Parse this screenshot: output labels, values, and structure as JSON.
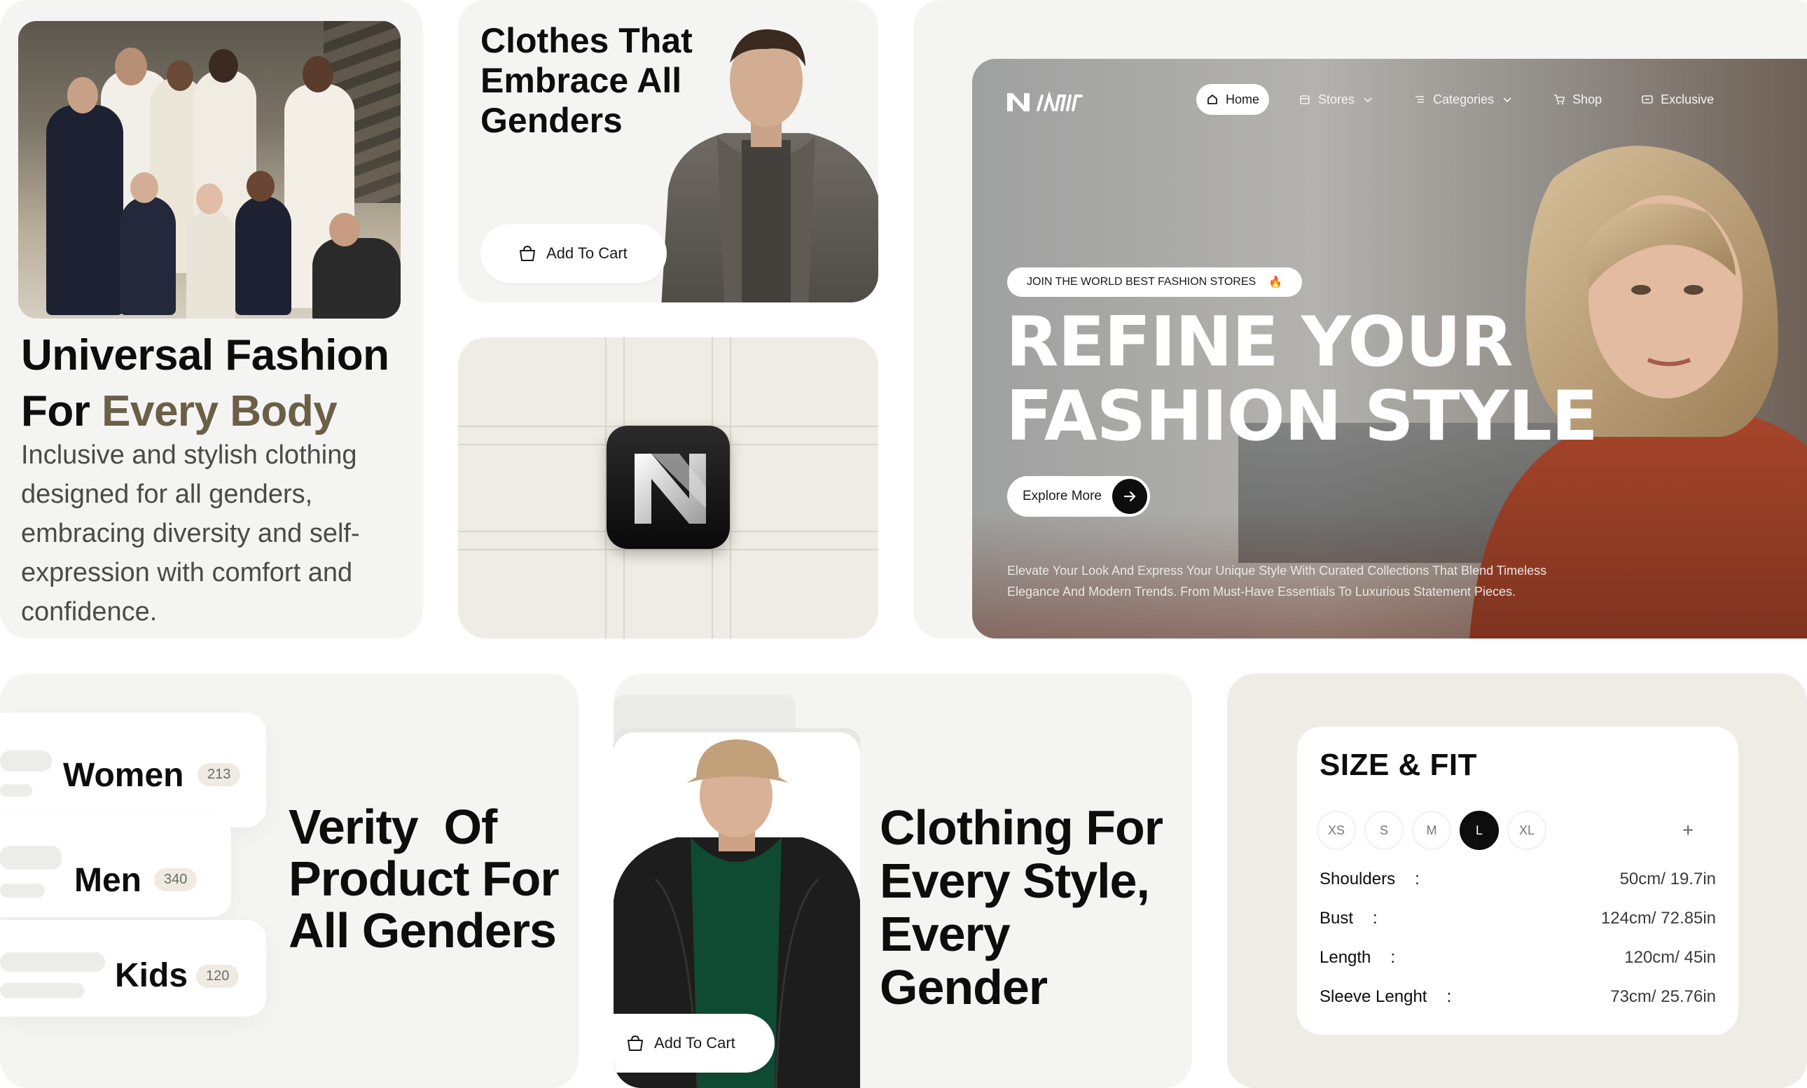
{
  "universal": {
    "title_line1": "Universal Fashion",
    "title_line2_prefix": "For ",
    "title_line2_accent": "Every Body",
    "description": "Inclusive and stylish clothing designed for all genders, embracing diversity and self-expression with comfort and confidence."
  },
  "embrace": {
    "title": "Clothes That Embrace All Genders",
    "cart_label": "Add To Cart"
  },
  "hero": {
    "brand": "",
    "nav": [
      {
        "label": "Home",
        "icon": "home-icon",
        "active": true
      },
      {
        "label": "Stores",
        "icon": "store-icon",
        "dropdown": true
      },
      {
        "label": "Categories",
        "icon": "list-icon",
        "dropdown": true
      },
      {
        "label": "Shop",
        "icon": "cart-icon"
      },
      {
        "label": "Exclusive",
        "icon": "ticket-icon"
      }
    ],
    "badge": "JOIN THE WORLD BEST FASHION STORES",
    "badge_emoji": "🔥",
    "headline_line1": "REFINE YOUR",
    "headline_line2": "FASHION STYLE",
    "cta": "Explore More",
    "description": "Elevate Your Look And Express Your Unique Style With Curated Collections That Blend Timeless Elegance And Modern Trends. From Must-Have Essentials To Luxurious Statement Pieces."
  },
  "categories": {
    "items": [
      {
        "label": "Women",
        "count": "213"
      },
      {
        "label": "Men",
        "count": "340"
      },
      {
        "label": "Kids",
        "count": "120"
      }
    ],
    "title": "Verity  Of\nProduct For\nAll Genders"
  },
  "style": {
    "title": "Clothing For Every Style, Every Gender",
    "cart_label": "Add To Cart"
  },
  "size_fit": {
    "title": "SIZE & FIT",
    "sizes": [
      "XS",
      "S",
      "M",
      "L",
      "XL"
    ],
    "selected": "L",
    "plus": "+",
    "rows": [
      {
        "label": "Shoulders",
        "value": "50cm/ 19.7in"
      },
      {
        "label": "Bust",
        "value": "124cm/ 72.85in"
      },
      {
        "label": "Length",
        "value": "120cm/ 45in"
      },
      {
        "label": "Sleeve Lenght",
        "value": "73cm/ 25.76in"
      }
    ]
  },
  "colors": {
    "accent_brown": "#6c5f48",
    "card_bg": "#f4f4f3",
    "beige_bg": "#efece5"
  }
}
